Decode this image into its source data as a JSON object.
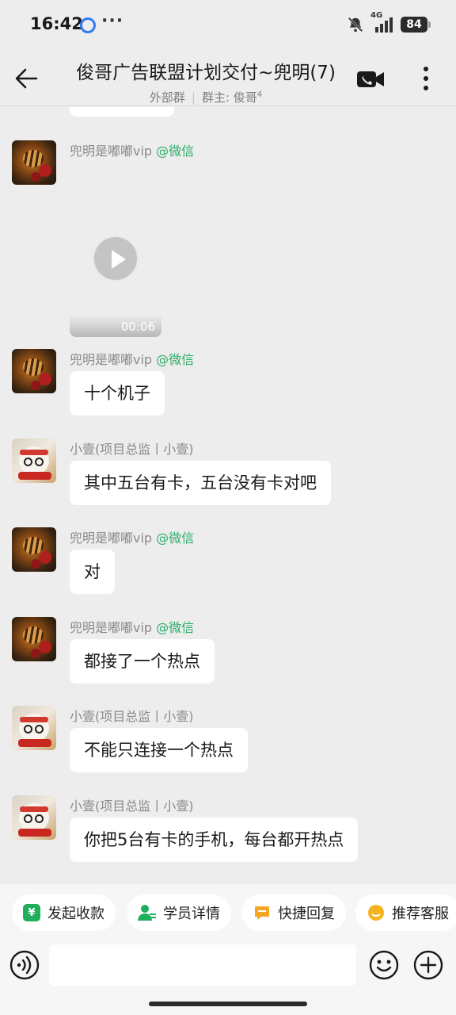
{
  "status_bar": {
    "time": "16:42",
    "dots": "···",
    "network": "4G",
    "battery": "84"
  },
  "header": {
    "title": "俊哥广告联盟计划交付~兜明(7)",
    "subtitle_tag": "外部群",
    "subtitle_separator": "|",
    "subtitle_owner": "群主: 俊哥",
    "subtitle_owner_sup": "4"
  },
  "messages": [
    {
      "sender_name": "兜明是嘟嘟vip",
      "sender_tag": "@微信",
      "avatar": "tiger-avatar",
      "type": "video",
      "duration": "00:06"
    },
    {
      "sender_name": "兜明是嘟嘟vip",
      "sender_tag": "@微信",
      "avatar": "tiger-avatar",
      "type": "text",
      "text": "十个机子"
    },
    {
      "sender_name": "小壹(项目总监丨小壹)",
      "sender_tag": "",
      "avatar": "dog-avatar",
      "type": "text",
      "text": "其中五台有卡，五台没有卡对吧"
    },
    {
      "sender_name": "兜明是嘟嘟vip",
      "sender_tag": "@微信",
      "avatar": "tiger-avatar",
      "type": "text",
      "text": "对"
    },
    {
      "sender_name": "兜明是嘟嘟vip",
      "sender_tag": "@微信",
      "avatar": "tiger-avatar",
      "type": "text",
      "text": "都接了一个热点"
    },
    {
      "sender_name": "小壹(项目总监丨小壹)",
      "sender_tag": "",
      "avatar": "dog-avatar",
      "type": "text",
      "text": "不能只连接一个热点"
    },
    {
      "sender_name": "小壹(项目总监丨小壹)",
      "sender_tag": "",
      "avatar": "dog-avatar",
      "type": "text",
      "text": "你把5台有卡的手机，每台都开热点"
    }
  ],
  "quick_replies": [
    {
      "label": "发起收款",
      "icon": "yen-icon",
      "icon_glyph": "¥"
    },
    {
      "label": "学员详情",
      "icon": "user-icon",
      "icon_glyph": ""
    },
    {
      "label": "快捷回复",
      "icon": "reply-icon",
      "icon_glyph": ""
    },
    {
      "label": "推荐客服",
      "icon": "service-icon",
      "icon_glyph": ""
    }
  ],
  "input": {
    "value": "",
    "placeholder": ""
  },
  "colors": {
    "background": "#ededed",
    "bubble": "#ffffff",
    "wechat_green": "#2aae67"
  }
}
